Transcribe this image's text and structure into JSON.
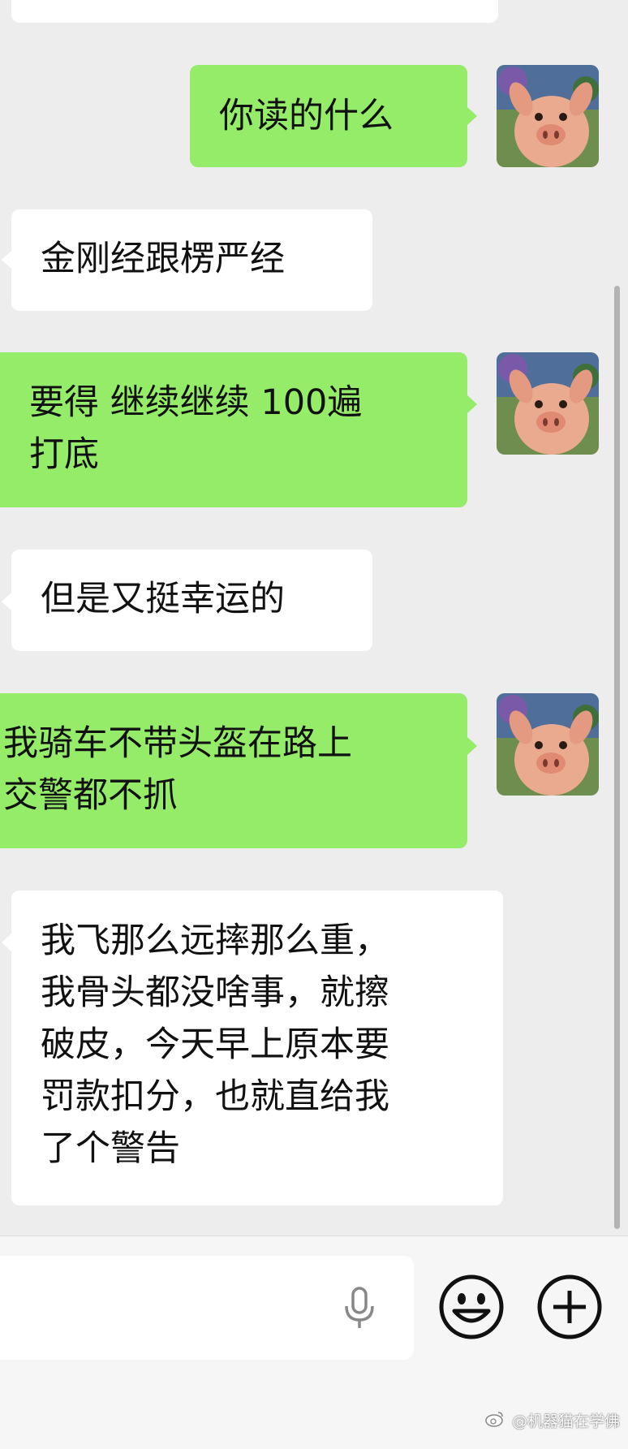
{
  "messages": [
    {
      "side": "in",
      "text": ""
    },
    {
      "side": "out",
      "text": "你读的什么"
    },
    {
      "side": "in",
      "text": "金刚经跟楞严经"
    },
    {
      "side": "out",
      "text": "要得 继续继续 100遍\n打底"
    },
    {
      "side": "in",
      "text": "但是又挺幸运的"
    },
    {
      "side": "out",
      "text": "我骑车不带头盔在路上\n交警都不抓"
    },
    {
      "side": "in",
      "text": "我飞那么远摔那么重，\n我骨头都没啥事，就擦\n破皮，今天早上原本要\n罚款扣分，也就直给我\n了个警告"
    }
  ],
  "input": {
    "icons": [
      "microphone-icon",
      "emoji-icon",
      "plus-icon"
    ]
  },
  "watermark": "@机器猫在学佛",
  "colors": {
    "outgoing": "#95ec69",
    "incoming": "#ffffff",
    "background": "#ededed"
  }
}
